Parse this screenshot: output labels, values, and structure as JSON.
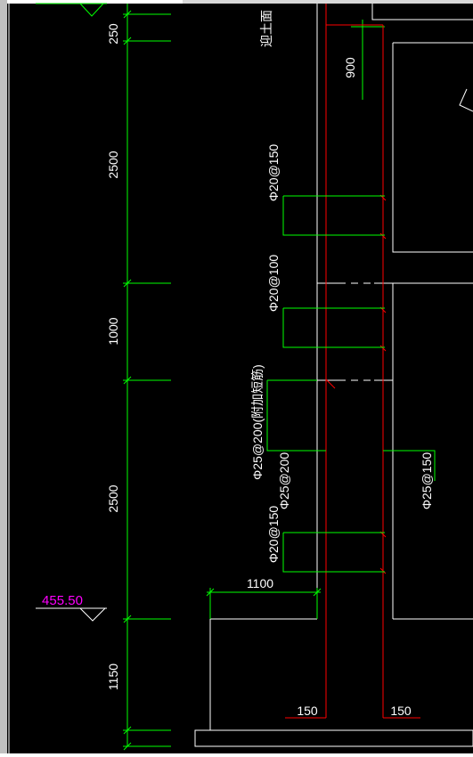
{
  "drawing": {
    "top_note": "迎土面",
    "elevation_label": "455.50",
    "dim_top_width": "900",
    "dim_slab_width": "1100",
    "dim_bottom_left": "150",
    "dim_bottom_right": "150",
    "vertical_dims": [
      "250",
      "2500",
      "1000",
      "2500",
      "1150"
    ],
    "rebar_labels": {
      "upper_150": "Φ20@150",
      "middle_100": "Φ20@100",
      "vertical_200_note": "Φ25@200(附加短筋)",
      "vertical_200": "Φ25@200",
      "lower_150": "Φ20@150",
      "right_150": "Φ25@150"
    }
  },
  "colors": {
    "background": "#000000",
    "border": "#ffffff",
    "structure": "#ffffff",
    "dimension": "#00ff00",
    "rebar": "#ff0000",
    "elevation": "#ff00ff",
    "label": "#ffffff"
  }
}
